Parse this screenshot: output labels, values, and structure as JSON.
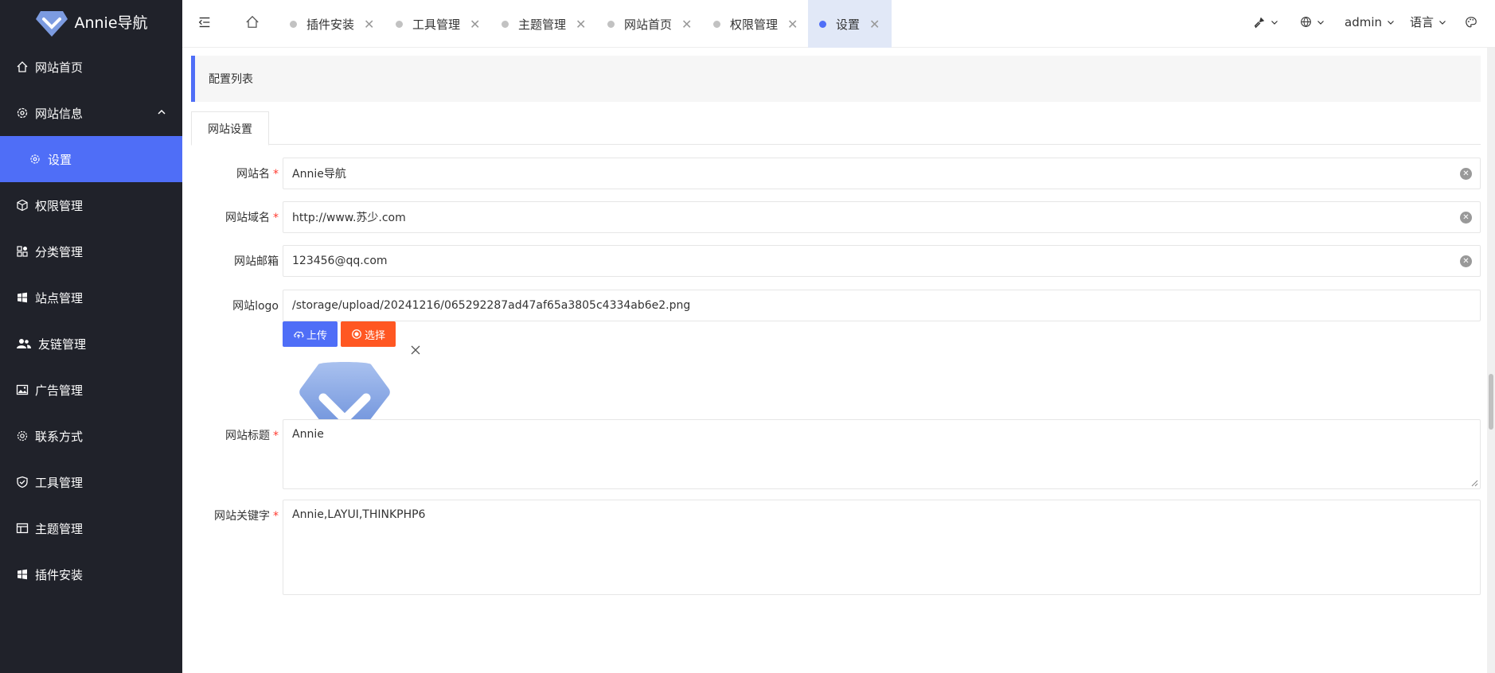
{
  "brand": {
    "name": "Annie导航"
  },
  "sidebar": {
    "items": [
      {
        "label": "网站首页",
        "icon": "home-icon"
      },
      {
        "label": "网站信息",
        "icon": "gear-icon"
      },
      {
        "label": "设置",
        "icon": "gear-icon"
      },
      {
        "label": "权限管理",
        "icon": "cube-icon"
      },
      {
        "label": "分类管理",
        "icon": "apps-icon"
      },
      {
        "label": "站点管理",
        "icon": "windows-icon"
      },
      {
        "label": "友链管理",
        "icon": "users-icon"
      },
      {
        "label": "广告管理",
        "icon": "image-icon"
      },
      {
        "label": "联系方式",
        "icon": "gear-outline-icon"
      },
      {
        "label": "工具管理",
        "icon": "shield-check-icon"
      },
      {
        "label": "主题管理",
        "icon": "layout-icon"
      },
      {
        "label": "插件安装",
        "icon": "windows-icon"
      }
    ]
  },
  "topbar": {
    "tabs": [
      {
        "label": "插件安装"
      },
      {
        "label": "工具管理"
      },
      {
        "label": "主题管理"
      },
      {
        "label": "网站首页"
      },
      {
        "label": "权限管理"
      },
      {
        "label": "设置"
      }
    ],
    "close_symbol": "✕",
    "user": "admin",
    "language": "语言"
  },
  "main": {
    "header": "配置列表",
    "form_tab": "网站设置",
    "fields": {
      "site_name": {
        "label": "网站名",
        "value": "Annie导航"
      },
      "site_domain": {
        "label": "网站域名",
        "value": "http://www.苏少.com"
      },
      "site_email": {
        "label": "网站邮箱",
        "value": "123456@qq.com"
      },
      "site_logo": {
        "label": "网站logo",
        "value": "/storage/upload/20241216/065292287ad47af65a3805c4334ab6e2.png"
      },
      "site_title": {
        "label": "网站标题",
        "value": "Annie"
      },
      "site_keywords": {
        "label": "网站关键字",
        "value": "Annie,LAYUI,THINKPHP6"
      }
    },
    "required_mark": "*",
    "upload_label": "上传",
    "select_label": "选择"
  },
  "colors": {
    "sidebar_bg": "#20222a",
    "accent": "#4f6ef7",
    "select_button": "#ff5722",
    "active_tab_bg": "#e1e8f7"
  }
}
